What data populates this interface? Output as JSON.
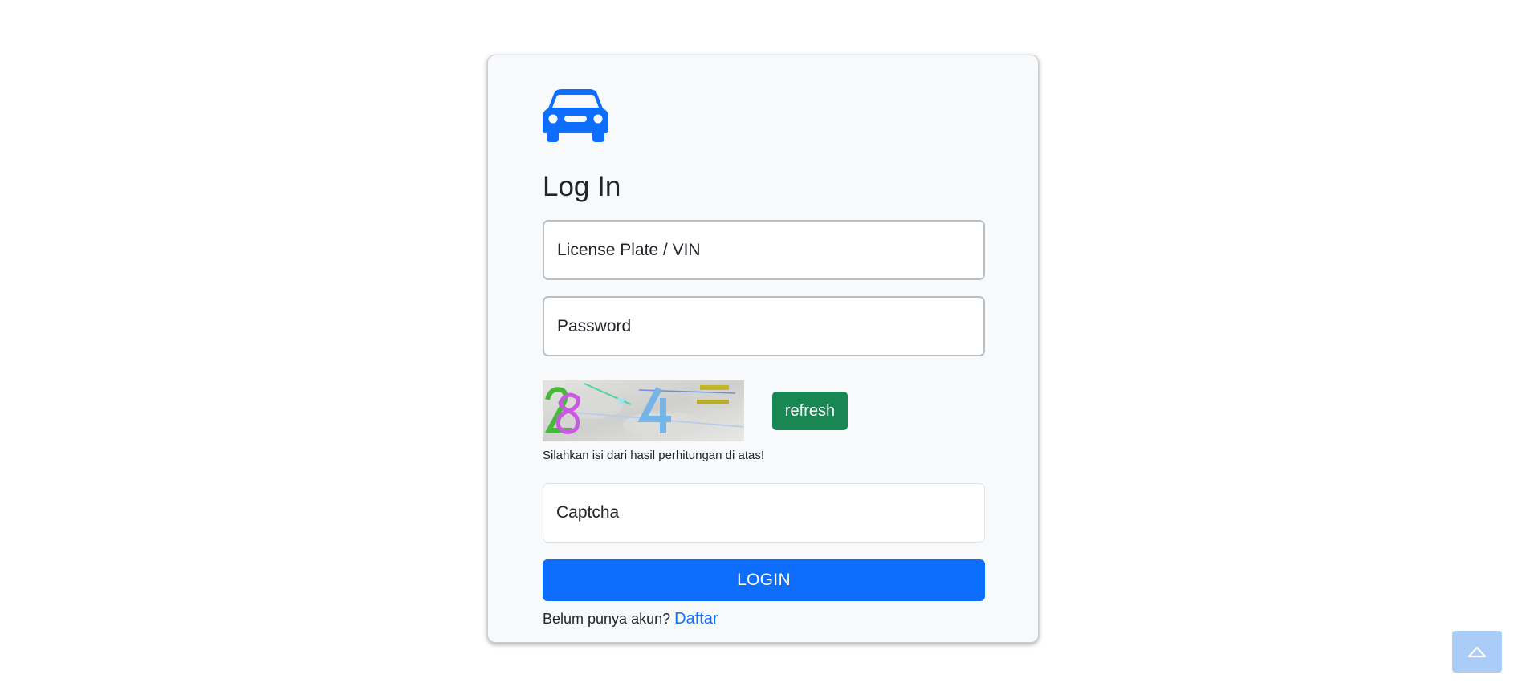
{
  "brand": {
    "logo_icon": "car-icon",
    "accent_color": "#0d6efd"
  },
  "form": {
    "title": "Log In",
    "username": {
      "placeholder": "License Plate / VIN",
      "value": ""
    },
    "password": {
      "placeholder": "Password",
      "value": ""
    },
    "captcha": {
      "image_icon": "captcha-image",
      "refresh_label": "refresh",
      "hint": "Silahkan isi dari hasil perhitungan di atas!",
      "placeholder": "Captcha",
      "value": ""
    },
    "login_label": "LOGIN",
    "signup_prompt": "Belum punya akun?",
    "signup_link": "Daftar"
  },
  "colors": {
    "primary": "#0d6efd",
    "success": "#198754",
    "card_bg": "#f8f9fa",
    "back_to_top": "#a9cdf7"
  },
  "back_to_top": {
    "icon": "chevron-up-icon"
  }
}
